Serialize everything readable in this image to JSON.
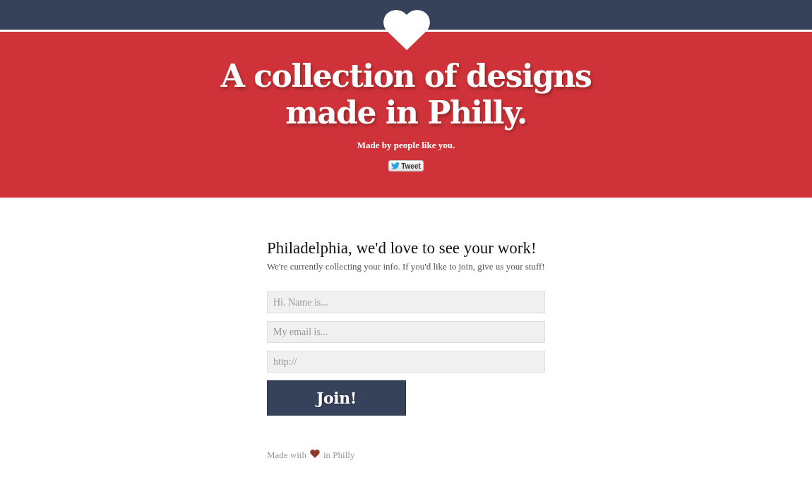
{
  "hero": {
    "heading": "A collection of designs made in Philly.",
    "tagline": "Made by people like you.",
    "tweet_button": {
      "label": "Tweet"
    }
  },
  "signup": {
    "title": "Philadelphia, we'd love to see your work!",
    "intro": "We're currently collecting your info. If you'd like to join, give us your stuff!",
    "fields": [
      {
        "placeholder": "Hi. Name is..."
      },
      {
        "placeholder": "My email is..."
      },
      {
        "placeholder": "http://"
      }
    ],
    "submit_button": {
      "label": "Join!"
    }
  },
  "footer": {
    "before": "Made with",
    "after": "in Philly"
  }
}
